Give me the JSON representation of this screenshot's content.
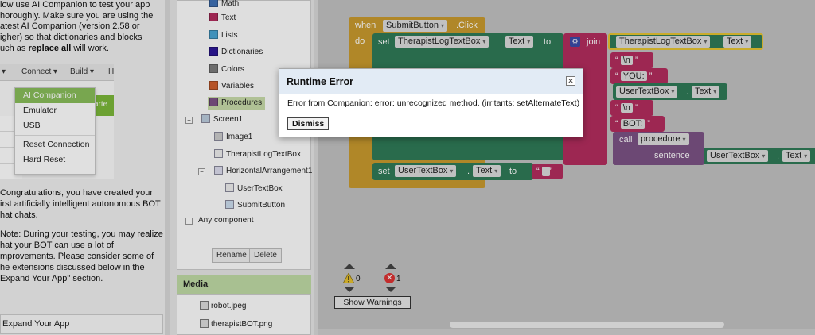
{
  "tutorial": {
    "intro_line1": "low use AI Companion to test your app",
    "intro_line2": "horoughly. Make sure you are using the",
    "intro_line3": "atest AI Companion (version 2.58 or",
    "intro_line4": "igher) so that dictionaries and blocks",
    "intro_line5_pre": "uch as ",
    "intro_line5_bold": "replace all",
    "intro_line5_post": " will work.",
    "menubar": [
      "▾",
      "Connect ▾",
      "Build ▾",
      "H"
    ],
    "teal_fragment": "arte",
    "connect_menu": [
      "AI Companion",
      "Emulator",
      "USB",
      "Reset Connection",
      "Hard Reset"
    ],
    "congrats_line1": "Congratulations, you have created your",
    "congrats_line2": "irst artificially intelligent autonomous BOT",
    "congrats_line3": "hat chats.",
    "note_line1": "Note: During your testing, you may realize",
    "note_line2": "hat your BOT can use a lot of",
    "note_line3": "mprovements. Please consider some of",
    "note_line4": "he extensions discussed below in the",
    "note_line5": "Expand Your App\" section.",
    "expand_button": "Expand Your App"
  },
  "palette": {
    "items": [
      {
        "label": "Math",
        "color": "#3f71b5"
      },
      {
        "label": "Text",
        "color": "#b32d5e"
      },
      {
        "label": "Lists",
        "color": "#49a6d4"
      },
      {
        "label": "Dictionaries",
        "color": "#2d1799"
      },
      {
        "label": "Colors",
        "color": "#7d7d7d"
      },
      {
        "label": "Variables",
        "color": "#d05f2d"
      },
      {
        "label": "Procedures",
        "color": "#7c5385"
      }
    ]
  },
  "components": {
    "screen": "Screen1",
    "image": "Image1",
    "log_textbox": "TherapistLogTextBox",
    "arrangement": "HorizontalArrangement1",
    "user_textbox": "UserTextBox",
    "submit_button": "SubmitButton",
    "any_component": "Any component",
    "rename_button": "Rename",
    "delete_button": "Delete"
  },
  "media": {
    "header": "Media",
    "files": [
      "robot.jpeg",
      "therapistBOT.png"
    ]
  },
  "blocks": {
    "when": "when",
    "event_component": "SubmitButton",
    "event_name": ".Click",
    "do": "do",
    "set": "set",
    "to": "to",
    "dot": ".",
    "log_box": "TherapistLogTextBox",
    "user_box": "UserTextBox",
    "text_prop": "Text",
    "join": "join",
    "str_newline": "\\n",
    "str_you": "YOU:",
    "str_bot": "BOT:",
    "call": "call",
    "procedure": "procedure",
    "sentence": "sentence",
    "open_quote": "“",
    "close_quote": "”"
  },
  "warnings": {
    "warning_count": "0",
    "error_count": "1",
    "show_warnings": "Show Warnings"
  },
  "dialog": {
    "title": "Runtime Error",
    "close": "✕",
    "message": "Error from Companion: error: unrecognized method. (irritants: setAlternateText)",
    "dismiss": "Dismiss"
  }
}
